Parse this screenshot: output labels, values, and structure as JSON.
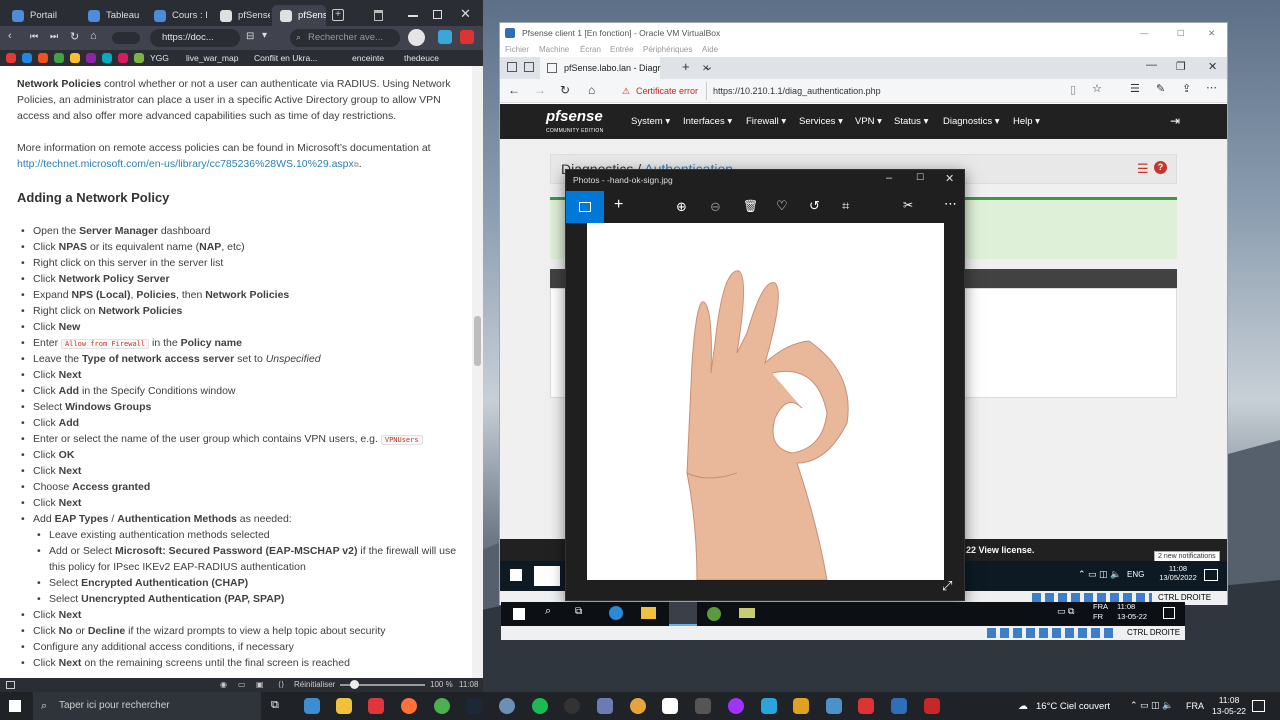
{
  "browser": {
    "tabs": [
      "Portail",
      "Tableau de",
      "Cours : IE",
      "pfSense-V",
      "pfSense®"
    ],
    "url": "https://doc...",
    "search_placeholder": "Rechercher ave...",
    "bookmarks": [
      "YGG",
      "live_war_map",
      "Conflit en Ukra...",
      "enceinte",
      "thedeuce"
    ],
    "status": {
      "reset": "Réinitialiser",
      "zoom": "100 %",
      "time": "11:08"
    }
  },
  "doc": {
    "p1_bold": "Network Policies",
    "p1_rest": " control whether or not a user can authenticate via RADIUS. Using Network Policies, an administrator can place a user in a specific Active Directory group to allow VPN access and also offer more advanced capabilities such as time of day restrictions.",
    "p2": "More information on remote access policies can be found in Microsoft’s documentation at",
    "link": "http://technet.microsoft.com/en-us/library/cc785236%28WS.10%29.aspx",
    "heading": "Adding a Network Policy",
    "steps": [
      {
        "pre": "Open the ",
        "b": "Server Manager",
        "post": " dashboard"
      },
      {
        "pre": "Click ",
        "b": "NPAS",
        "post": " or its equivalent name (",
        "b2": "NAP",
        "post2": ", etc)"
      },
      {
        "pre": "Right click on this server in the server list"
      },
      {
        "pre": "Click ",
        "b": "Network Policy Server"
      },
      {
        "pre": "Expand ",
        "b": "NPS (Local)",
        "post": ", ",
        "b2": "Policies",
        "post2": ", then ",
        "b3": "Network Policies"
      },
      {
        "pre": "Right click on ",
        "b": "Network Policies"
      },
      {
        "pre": "Click ",
        "b": "New"
      },
      {
        "pre": "Enter ",
        "code": "Allow from Firewall",
        "post": " in the ",
        "b": "Policy name"
      },
      {
        "pre": "Leave the ",
        "b": "Type of network access server",
        "post": " set to ",
        "i": "Unspecified"
      },
      {
        "pre": "Click ",
        "b": "Next"
      },
      {
        "pre": "Click ",
        "b": "Add",
        "post": " in the Specify Conditions window"
      },
      {
        "pre": "Select ",
        "b": "Windows Groups"
      },
      {
        "pre": "Click ",
        "b": "Add"
      },
      {
        "pre": "Enter or select the name of the user group which contains VPN users, e.g. ",
        "code": "VPNUsers"
      },
      {
        "pre": "Click ",
        "b": "OK"
      },
      {
        "pre": "Click ",
        "b": "Next"
      },
      {
        "pre": "Choose ",
        "b": "Access granted"
      },
      {
        "pre": "Click ",
        "b": "Next"
      },
      {
        "pre": "Add ",
        "b": "EAP Types",
        "post": " / ",
        "b2": "Authentication Methods",
        "post2": " as needed:"
      },
      {
        "sub": true,
        "pre": "Leave existing authentication methods selected"
      },
      {
        "sub": true,
        "wrap": true,
        "pre": "Add or Select ",
        "b": "Microsoft: Secured Password (EAP-MSCHAP v2)",
        "post": " if the firewall will use this policy for IPsec IKEv2 EAP-RADIUS authentication"
      },
      {
        "sub": true,
        "pre": "Select ",
        "b": "Encrypted Authentication (CHAP)"
      },
      {
        "sub": true,
        "pre": "Select ",
        "b": "Unencrypted Authentication (PAP, SPAP)"
      },
      {
        "pre": "Click ",
        "b": "Next"
      },
      {
        "pre": "Click ",
        "b": "No",
        "post": " or ",
        "b2": "Decline",
        "post2": " if the wizard prompts to view a help topic about security"
      },
      {
        "pre": "Configure any additional access conditions, if necessary"
      },
      {
        "pre": "Click ",
        "b": "Next",
        "post": " on the remaining screens until the final screen is reached"
      }
    ]
  },
  "vbox": {
    "title": "Pfsense client 1 [En fonction] - Oracle VM VirtualBox",
    "menu": [
      "Fichier",
      "Machine",
      "Écran",
      "Entrée",
      "Périphériques",
      "Aide"
    ],
    "edge_tab": "pfSense.labo.lan - Diagr",
    "cert_error": "Certificate error",
    "url": "https://10.210.1.1/diag_authentication.php",
    "pfsense_logo": "pfsense",
    "pfsense_edition": "COMMUNITY EDITION",
    "menu_items": [
      "System",
      "Interfaces",
      "Firewall",
      "Services",
      "VPN",
      "Status",
      "Diagnostics",
      "Help"
    ],
    "breadcrumb": [
      "Diagnostics",
      "Authentication"
    ],
    "footer_text": "22 View license.",
    "notification": "2 new notifications",
    "vm_clock": {
      "time": "11:08",
      "date": "13/05/2022"
    },
    "vm_lang": "ENG",
    "host_key": "CTRL DROITE"
  },
  "photos": {
    "title": "Photos - -hand-ok-sign.jpg"
  },
  "outer_taskbar": {
    "lang": "FRA",
    "lang2": "FR",
    "time": "11:08",
    "date": "13-05-22",
    "host_key": "CTRL DROITE"
  },
  "taskbar": {
    "search_placeholder": "Taper ici pour rechercher",
    "weather": "16°C Ciel couvert",
    "lang": "FRA",
    "time": "11:08",
    "date": "13-05-22"
  },
  "colors": {
    "pfsense_nav": "#212121",
    "accent": "#0078d7",
    "link": "#2980b9",
    "cert_error": "#c42b1c"
  }
}
